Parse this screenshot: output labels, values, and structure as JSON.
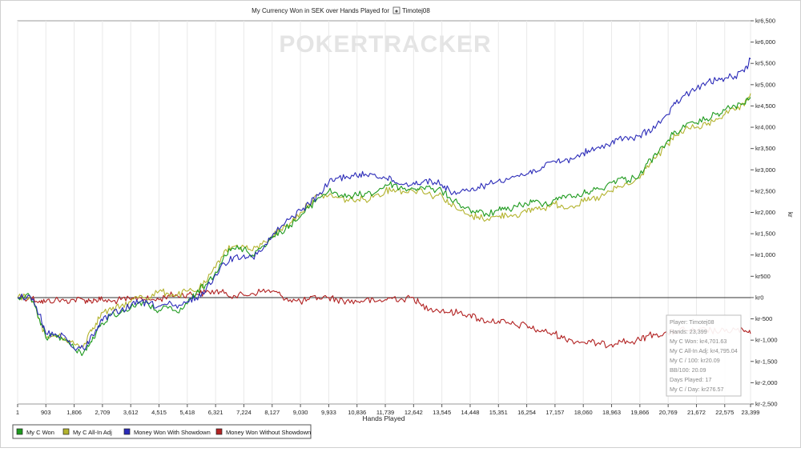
{
  "chart_data": {
    "type": "line",
    "title": "My Currency Won in SEK over Hands Played for",
    "title_player": "Timotej08",
    "watermark": "POKERTRACKER",
    "xlabel": "Hands Played",
    "ylabel": "kr",
    "xlim": [
      1,
      23399
    ],
    "ylim": [
      -2500,
      6500
    ],
    "grid": "vertical",
    "x_ticks": [
      1,
      903,
      1806,
      2709,
      3612,
      4515,
      5418,
      6321,
      7224,
      8127,
      9030,
      9933,
      10836,
      11739,
      12642,
      13545,
      14448,
      15351,
      16254,
      17157,
      18060,
      18963,
      19866,
      20769,
      21672,
      22575,
      23399
    ],
    "x_tick_labels": [
      "1",
      "903",
      "1,806",
      "2,709",
      "3,612",
      "4,515",
      "5,418",
      "6,321",
      "7,224",
      "8,127",
      "9,030",
      "9,933",
      "10,836",
      "11,739",
      "12,642",
      "13,545",
      "14,448",
      "15,351",
      "16,254",
      "17,157",
      "18,060",
      "18,963",
      "19,866",
      "20,769",
      "21,672",
      "22,575",
      "23,399"
    ],
    "y_ticks": [
      -2500,
      -2000,
      -1500,
      -1000,
      -500,
      0,
      500,
      1000,
      1500,
      2000,
      2500,
      3000,
      3500,
      4000,
      4500,
      5000,
      5500,
      6000,
      6500
    ],
    "y_tick_labels": [
      "kr-2,500",
      "kr-2,000",
      "kr-1,500",
      "kr-1,000",
      "kr-500",
      "kr0",
      "kr500",
      "kr1,000",
      "kr1,500",
      "kr2,000",
      "kr2,500",
      "kr3,000",
      "kr3,500",
      "kr4,000",
      "kr4,500",
      "kr5,000",
      "kr5,500",
      "kr6,000",
      "kr6,500"
    ],
    "legend_position": "bottom-left",
    "series": [
      {
        "name": "My C Won",
        "color": "#1e9a1e",
        "x": [
          1,
          400,
          700,
          903,
          1200,
          1500,
          1806,
          2100,
          2300,
          2500,
          2709,
          3000,
          3300,
          3612,
          3900,
          4200,
          4515,
          4800,
          5100,
          5418,
          5700,
          6000,
          6321,
          6600,
          6900,
          7224,
          7500,
          7800,
          8127,
          8400,
          8700,
          9030,
          9300,
          9600,
          9933,
          10200,
          10500,
          10836,
          11100,
          11400,
          11739,
          12000,
          12300,
          12642,
          12900,
          13200,
          13545,
          13800,
          14100,
          14448,
          14700,
          15000,
          15351,
          15600,
          15900,
          16254,
          16500,
          16800,
          17157,
          17400,
          17700,
          18060,
          18300,
          18600,
          18963,
          19200,
          19500,
          19866,
          20100,
          20400,
          20769,
          21000,
          21300,
          21672,
          22000,
          22300,
          22575,
          22900,
          23200,
          23399
        ],
        "y": [
          0,
          30,
          -500,
          -950,
          -850,
          -1000,
          -1200,
          -1300,
          -1100,
          -850,
          -600,
          -400,
          -350,
          -250,
          -100,
          -200,
          -300,
          -250,
          -350,
          -150,
          100,
          300,
          600,
          1000,
          1150,
          1150,
          1000,
          1200,
          1400,
          1550,
          1700,
          1900,
          2100,
          2350,
          2500,
          2450,
          2350,
          2400,
          2450,
          2450,
          2650,
          2650,
          2550,
          2550,
          2600,
          2550,
          2500,
          2350,
          2200,
          2050,
          2000,
          1950,
          2050,
          2050,
          2150,
          2200,
          2250,
          2200,
          2300,
          2400,
          2350,
          2450,
          2500,
          2550,
          2700,
          2800,
          2750,
          2900,
          3150,
          3350,
          3700,
          3900,
          4000,
          4100,
          4200,
          4300,
          4400,
          4500,
          4550,
          4701.63
        ]
      },
      {
        "name": "My C All-In Adj",
        "color": "#b3b32e",
        "x": [
          1,
          400,
          700,
          903,
          1200,
          1500,
          1806,
          2100,
          2300,
          2500,
          2709,
          3000,
          3300,
          3612,
          3900,
          4200,
          4515,
          4800,
          5100,
          5418,
          5700,
          6000,
          6321,
          6600,
          6900,
          7224,
          7500,
          7800,
          8127,
          8400,
          8700,
          9030,
          9300,
          9600,
          9933,
          10200,
          10500,
          10836,
          11100,
          11400,
          11739,
          12000,
          12300,
          12642,
          12900,
          13200,
          13545,
          13800,
          14100,
          14448,
          14700,
          15000,
          15351,
          15600,
          15900,
          16254,
          16500,
          16800,
          17157,
          17400,
          17700,
          18060,
          18300,
          18600,
          18963,
          19200,
          19500,
          19866,
          20100,
          20400,
          20769,
          21000,
          21300,
          21672,
          22000,
          22300,
          22575,
          22900,
          23200,
          23399
        ],
        "y": [
          0,
          30,
          -500,
          -950,
          -900,
          -950,
          -1100,
          -1150,
          -800,
          -600,
          -350,
          -300,
          -200,
          -100,
          50,
          0,
          150,
          100,
          50,
          150,
          150,
          350,
          700,
          1100,
          1200,
          1200,
          1100,
          1250,
          1450,
          1600,
          1750,
          2000,
          2200,
          2400,
          2400,
          2350,
          2300,
          2300,
          2300,
          2400,
          2500,
          2550,
          2500,
          2500,
          2550,
          2400,
          2400,
          2200,
          2050,
          1900,
          1900,
          1850,
          1900,
          1950,
          1950,
          2000,
          2100,
          2100,
          2200,
          2150,
          2150,
          2250,
          2300,
          2350,
          2500,
          2600,
          2650,
          2800,
          3100,
          3300,
          3600,
          3800,
          3950,
          4000,
          4050,
          4200,
          4300,
          4400,
          4500,
          4795.04
        ]
      },
      {
        "name": "Money Won With Showdown",
        "color": "#2b2bb8",
        "x": [
          1,
          400,
          700,
          903,
          1200,
          1500,
          1806,
          2100,
          2300,
          2500,
          2709,
          3000,
          3300,
          3612,
          3900,
          4200,
          4515,
          4800,
          5100,
          5418,
          5700,
          6000,
          6321,
          6600,
          6900,
          7224,
          7500,
          7800,
          8127,
          8400,
          8700,
          9030,
          9300,
          9600,
          9933,
          10200,
          10500,
          10836,
          11100,
          11400,
          11739,
          12000,
          12300,
          12642,
          12900,
          13200,
          13545,
          13800,
          14100,
          14448,
          14700,
          15000,
          15351,
          15600,
          15900,
          16254,
          16500,
          16800,
          17157,
          17400,
          17700,
          18060,
          18300,
          18600,
          18963,
          19200,
          19500,
          19866,
          20100,
          20400,
          20769,
          21000,
          21300,
          21672,
          22000,
          22300,
          22575,
          22900,
          23200,
          23399
        ],
        "y": [
          0,
          30,
          -400,
          -850,
          -850,
          -900,
          -1200,
          -1200,
          -1000,
          -750,
          -550,
          -400,
          -300,
          -200,
          -100,
          -150,
          -200,
          -150,
          -250,
          -100,
          0,
          150,
          550,
          800,
          950,
          1000,
          950,
          1100,
          1450,
          1650,
          1850,
          2050,
          2200,
          2400,
          2700,
          2800,
          2850,
          2850,
          2900,
          2900,
          2800,
          2750,
          2650,
          2700,
          2700,
          2750,
          2650,
          2500,
          2450,
          2500,
          2600,
          2650,
          2750,
          2800,
          2850,
          2900,
          3000,
          3050,
          3200,
          3200,
          3250,
          3400,
          3450,
          3500,
          3650,
          3750,
          3700,
          3800,
          3900,
          4050,
          4300,
          4550,
          4750,
          4900,
          5050,
          5100,
          5150,
          5200,
          5300,
          5600
        ]
      },
      {
        "name": "Money Won Without Showdown",
        "color": "#b22222",
        "x": [
          1,
          400,
          700,
          903,
          1200,
          1500,
          1806,
          2100,
          2300,
          2500,
          2709,
          3000,
          3300,
          3612,
          3900,
          4200,
          4515,
          4800,
          5100,
          5418,
          5700,
          6000,
          6321,
          6600,
          6900,
          7224,
          7500,
          7800,
          8127,
          8400,
          8700,
          9030,
          9300,
          9600,
          9933,
          10200,
          10500,
          10836,
          11100,
          11400,
          11739,
          12000,
          12300,
          12642,
          12900,
          13200,
          13545,
          13800,
          14100,
          14448,
          14700,
          15000,
          15351,
          15600,
          15900,
          16254,
          16500,
          16800,
          17157,
          17400,
          17700,
          18060,
          18300,
          18600,
          18963,
          19200,
          19500,
          19866,
          20100,
          20400,
          20769,
          21000,
          21300,
          21672,
          22000,
          22300,
          22575,
          22900,
          23200,
          23399
        ],
        "y": [
          0,
          0,
          -80,
          -100,
          -50,
          -80,
          -50,
          -50,
          -80,
          -50,
          -50,
          -100,
          -50,
          -50,
          0,
          -50,
          -50,
          50,
          50,
          80,
          80,
          120,
          150,
          100,
          50,
          50,
          100,
          150,
          150,
          50,
          -50,
          -100,
          -50,
          0,
          0,
          -50,
          -80,
          -100,
          -50,
          -100,
          -50,
          0,
          -50,
          0,
          -200,
          -250,
          -300,
          -350,
          -350,
          -400,
          -500,
          -550,
          -550,
          -600,
          -650,
          -650,
          -750,
          -800,
          -850,
          -950,
          -1000,
          -1050,
          -1050,
          -1100,
          -1100,
          -1000,
          -1050,
          -1000,
          -900,
          -850,
          -850,
          -800,
          -750,
          -800,
          -750,
          -800,
          -800,
          -750,
          -800,
          -850
        ]
      }
    ]
  },
  "tooltip": {
    "lines": [
      "Player: Timotej08",
      "Hands: 23,399",
      "My C Won: kr4,701.63",
      "My C All-In Adj: kr4,795.04",
      "My C / 100: kr20.09",
      "BB/100: 20.09",
      "Days Played: 17",
      "My C / Day: kr276.57"
    ]
  }
}
